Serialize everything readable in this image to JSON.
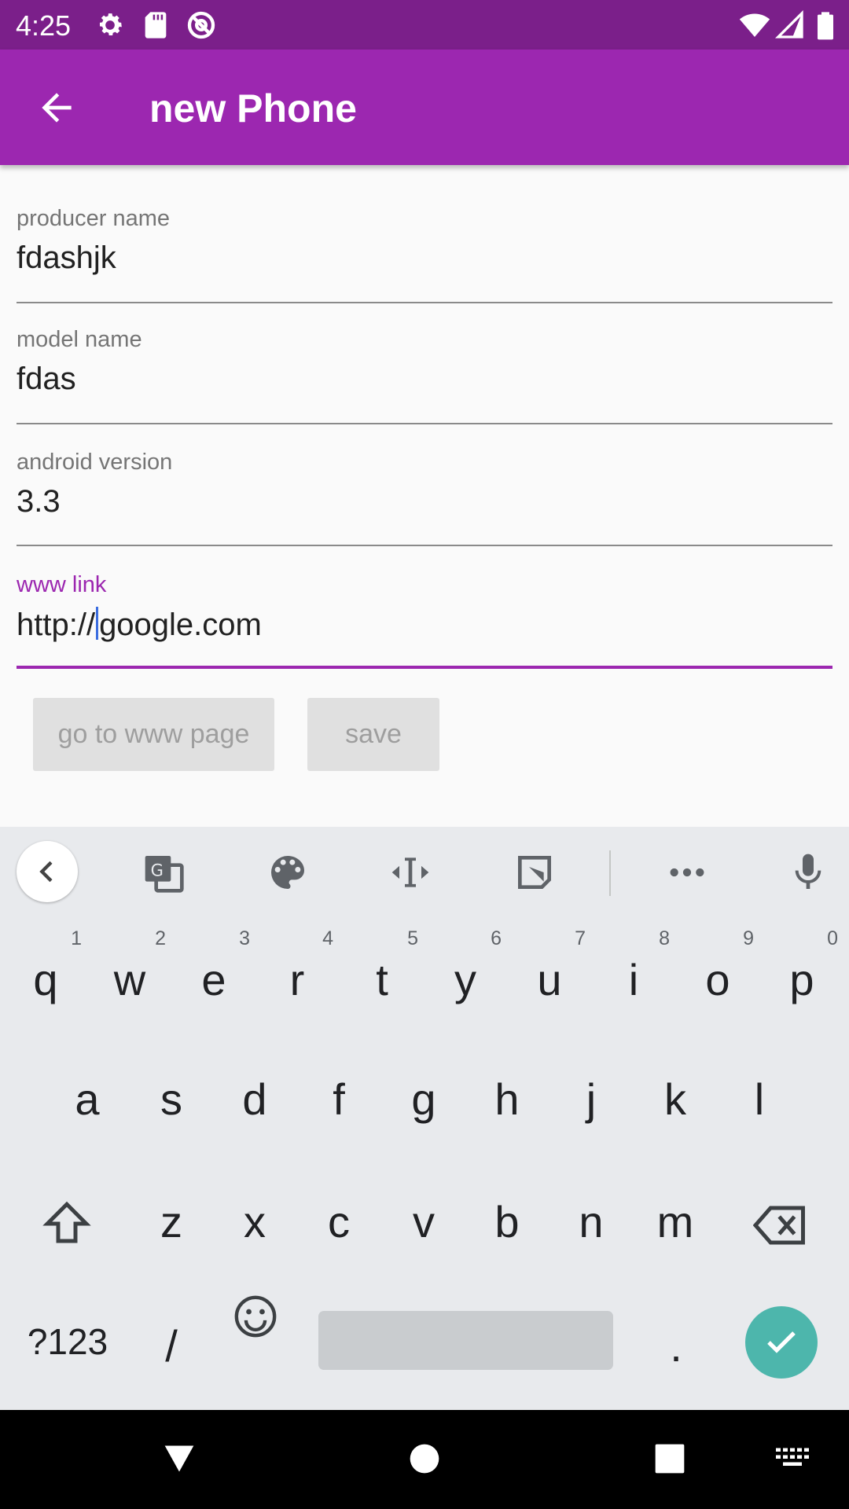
{
  "status_bar": {
    "time": "4:25",
    "left_icons": [
      "gear-icon",
      "sd-card-icon",
      "at-sign-icon"
    ],
    "right_icons": [
      "wifi-icon",
      "signal-icon",
      "battery-icon"
    ],
    "background": "#7b1f8a"
  },
  "app_bar": {
    "title": "new Phone",
    "back_icon": "arrow-back-icon",
    "color": "#9c27b0"
  },
  "form": {
    "fields": [
      {
        "label": "producer name",
        "value": "fdashjk"
      },
      {
        "label": "model name",
        "value": "fdas"
      },
      {
        "label": "android version",
        "value": "3.3"
      },
      {
        "label": "www link",
        "value_before_cursor": "http://",
        "value_after_cursor": "google.com",
        "focused": true
      }
    ],
    "accent_color": "#9c27b0"
  },
  "buttons": {
    "go_to_www": "go to www page",
    "save": "save"
  },
  "keyboard": {
    "toolbar_icons": [
      "chevron-left-icon",
      "translate-icon",
      "palette-icon",
      "text-cursor-icon",
      "floating-keyboard-icon",
      "more-icon",
      "mic-icon"
    ],
    "row1": [
      {
        "k": "q",
        "n": "1"
      },
      {
        "k": "w",
        "n": "2"
      },
      {
        "k": "e",
        "n": "3"
      },
      {
        "k": "r",
        "n": "4"
      },
      {
        "k": "t",
        "n": "5"
      },
      {
        "k": "y",
        "n": "6"
      },
      {
        "k": "u",
        "n": "7"
      },
      {
        "k": "i",
        "n": "8"
      },
      {
        "k": "o",
        "n": "9"
      },
      {
        "k": "p",
        "n": "0"
      }
    ],
    "row2": [
      "a",
      "s",
      "d",
      "f",
      "g",
      "h",
      "j",
      "k",
      "l"
    ],
    "row3": [
      "z",
      "x",
      "c",
      "v",
      "b",
      "n",
      "m"
    ],
    "row4": {
      "symbols": "?123",
      "slash": "/",
      "period": "."
    },
    "enter_color": "#4db6ac"
  },
  "nav_bar": {
    "icons": [
      "back-triangle-icon",
      "home-circle-icon",
      "recents-square-icon",
      "keyboard-switch-icon"
    ]
  }
}
